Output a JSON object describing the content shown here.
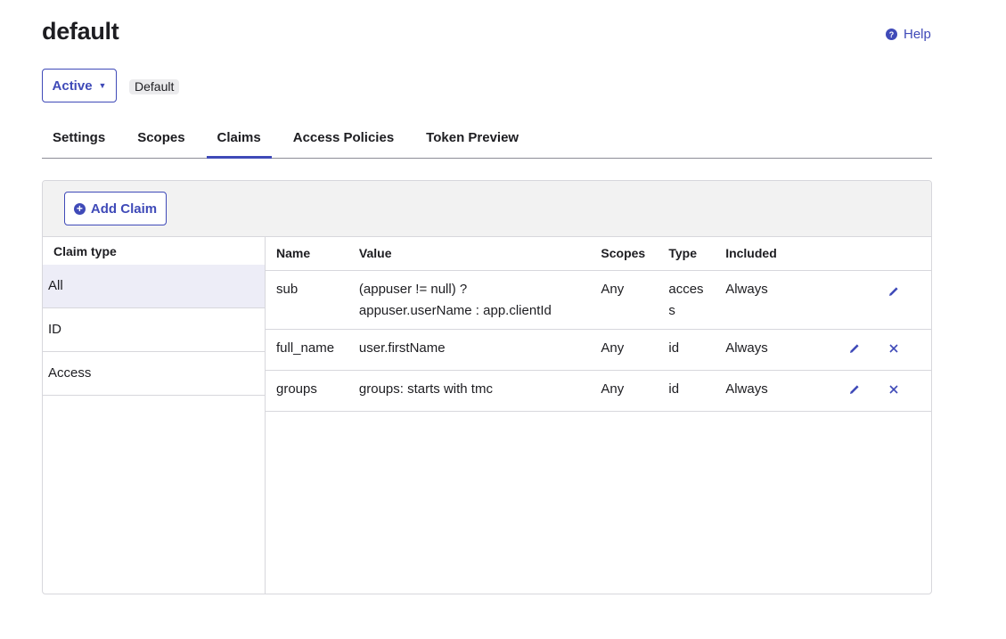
{
  "header": {
    "title": "default",
    "help_label": "Help"
  },
  "status": {
    "selected": "Active",
    "badge": "Default"
  },
  "tabs": [
    {
      "label": "Settings"
    },
    {
      "label": "Scopes"
    },
    {
      "label": "Claims"
    },
    {
      "label": "Access Policies"
    },
    {
      "label": "Token Preview"
    }
  ],
  "active_tab": "Claims",
  "toolbar": {
    "add_label": "Add Claim"
  },
  "claim_types": {
    "header": "Claim type",
    "items": [
      {
        "label": "All"
      },
      {
        "label": "ID"
      },
      {
        "label": "Access"
      }
    ],
    "selected": "All"
  },
  "table": {
    "columns": {
      "name": "Name",
      "value": "Value",
      "scopes": "Scopes",
      "type": "Type",
      "included": "Included"
    },
    "rows": [
      {
        "name": "sub",
        "value": "(appuser != null) ? appuser.userName : app.clientId",
        "scopes": "Any",
        "type": "access",
        "included": "Always"
      },
      {
        "name": "full_name",
        "value": "user.firstName",
        "scopes": "Any",
        "type": "id",
        "included": "Always"
      },
      {
        "name": "groups",
        "value": "groups: starts with tmc",
        "scopes": "Any",
        "type": "id",
        "included": "Always"
      }
    ]
  },
  "colors": {
    "accent": "#3f4ab8",
    "border": "#d7d7dc",
    "toolbar_bg": "#f2f2f2",
    "selected_bg": "#ededf7"
  },
  "icons": {
    "help": "help-circle-icon",
    "add": "plus-circle-icon",
    "edit": "pencil-icon",
    "delete": "close-icon",
    "caret": "caret-down-icon"
  }
}
